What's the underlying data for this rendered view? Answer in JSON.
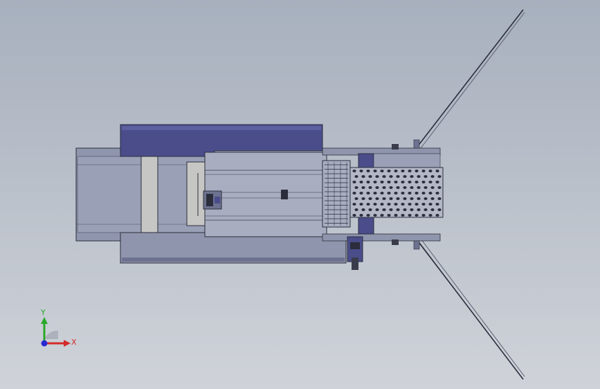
{
  "triad": {
    "x_label": "X",
    "y_label": "Y",
    "x_color": "#d42a2a",
    "y_color": "#2aa82a",
    "z_color": "#2a2ad4"
  },
  "colors": {
    "frame": "#8f95ac",
    "frame_dark": "#6d7290",
    "hopper": "#4a4d8a",
    "hopper_light": "#5c60a0",
    "panel": "#c6c7c4",
    "conveyor": "#a8adc0",
    "outline": "#2b2d3c"
  }
}
